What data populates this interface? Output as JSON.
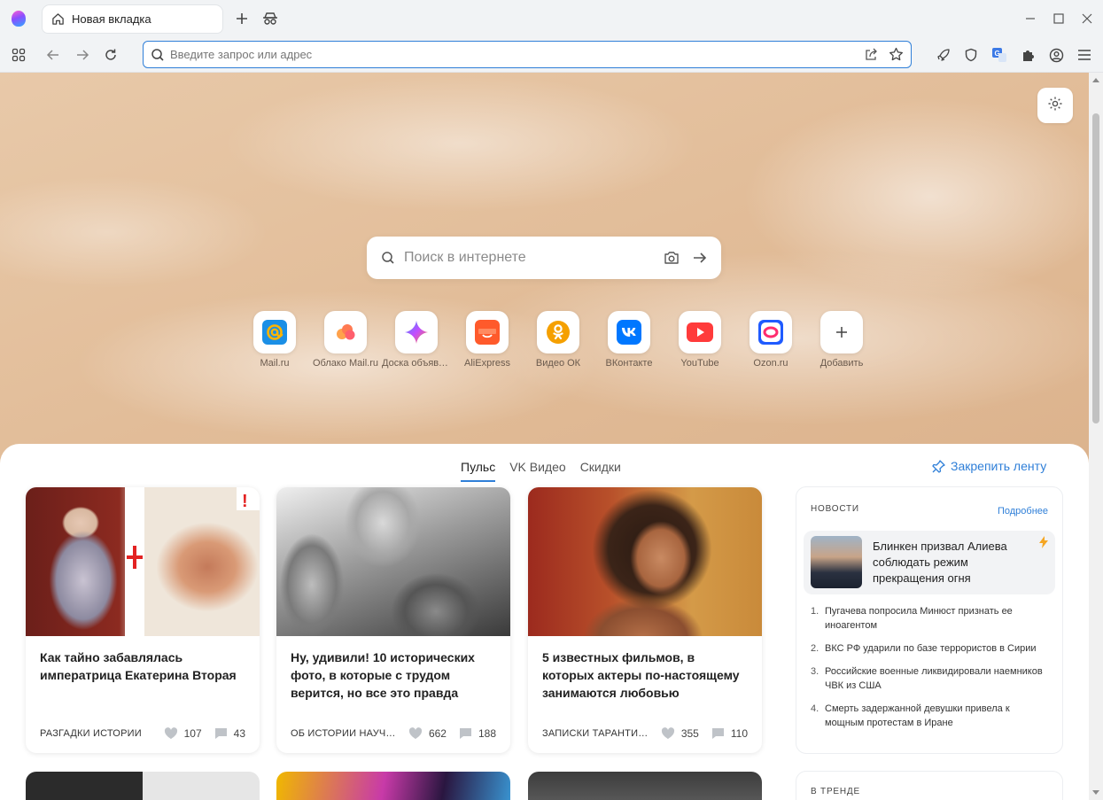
{
  "browser": {
    "tab_title": "Новая вкладка",
    "address_placeholder": "Введите запрос или адрес"
  },
  "start_page": {
    "search_placeholder": "Поиск в интернете",
    "tiles": [
      {
        "label": "Mail.ru",
        "icon": "mailru-icon"
      },
      {
        "label": "Облако Mail.ru",
        "icon": "cloud-icon"
      },
      {
        "label": "Доска объявлений",
        "icon": "sparkle-icon"
      },
      {
        "label": "AliExpress",
        "icon": "aliexpress-icon"
      },
      {
        "label": "Видео ОК",
        "icon": "ok-icon"
      },
      {
        "label": "ВКонтакте",
        "icon": "vk-icon"
      },
      {
        "label": "YouTube",
        "icon": "youtube-icon"
      },
      {
        "label": "Ozon.ru",
        "icon": "ozon-icon"
      },
      {
        "label": "Добавить",
        "icon": "plus-icon"
      }
    ]
  },
  "feed": {
    "tabs": [
      "Пульс",
      "VK Видео",
      "Скидки"
    ],
    "active_tab": "Пульс",
    "pin_label": "Закрепить ленту",
    "cards": [
      {
        "title": "Как тайно забавлялась императрица Екатерина Вторая",
        "source": "РАЗГАДКИ ИСТОРИИ",
        "likes": "107",
        "comments": "43"
      },
      {
        "title": "Ну, удивили! 10 исторических фото, в которые с трудом верится, но все это правда",
        "source": "ОБ ИСТОРИИ НАУЧНО",
        "likes": "662",
        "comments": "188"
      },
      {
        "title": "5 известных фильмов, в которых актеры по-настоящему занимаются любовью",
        "source": "ЗАПИСКИ ТАРАНТИНО",
        "likes": "355",
        "comments": "110"
      }
    ]
  },
  "news": {
    "header": "НОВОСТИ",
    "more_label": "Подробнее",
    "top_story": "Блинken призвал Алиева соблюдать режим прекращения огня",
    "items": [
      {
        "num": "1.",
        "text": "Пугачева попросила Минюст признать ее иноагентом"
      },
      {
        "num": "2.",
        "text": "ВКС РФ ударили по базе террористов в Сирии"
      },
      {
        "num": "3.",
        "text": "Российские военные ликвидировали наемников ЧВК из США"
      },
      {
        "num": "4.",
        "text": "Смерть задержанной девушки привела к мощным протестам в Иране"
      }
    ]
  },
  "trends": {
    "header": "В ТРЕНДЕ"
  },
  "colors": {
    "accent": "#2f7fd8",
    "vk": "#0077ff",
    "youtube": "#ff3b3b",
    "ok": "#f5a000",
    "aliexpress": "#ff5a2b",
    "mailru": "#1b8fe6"
  }
}
